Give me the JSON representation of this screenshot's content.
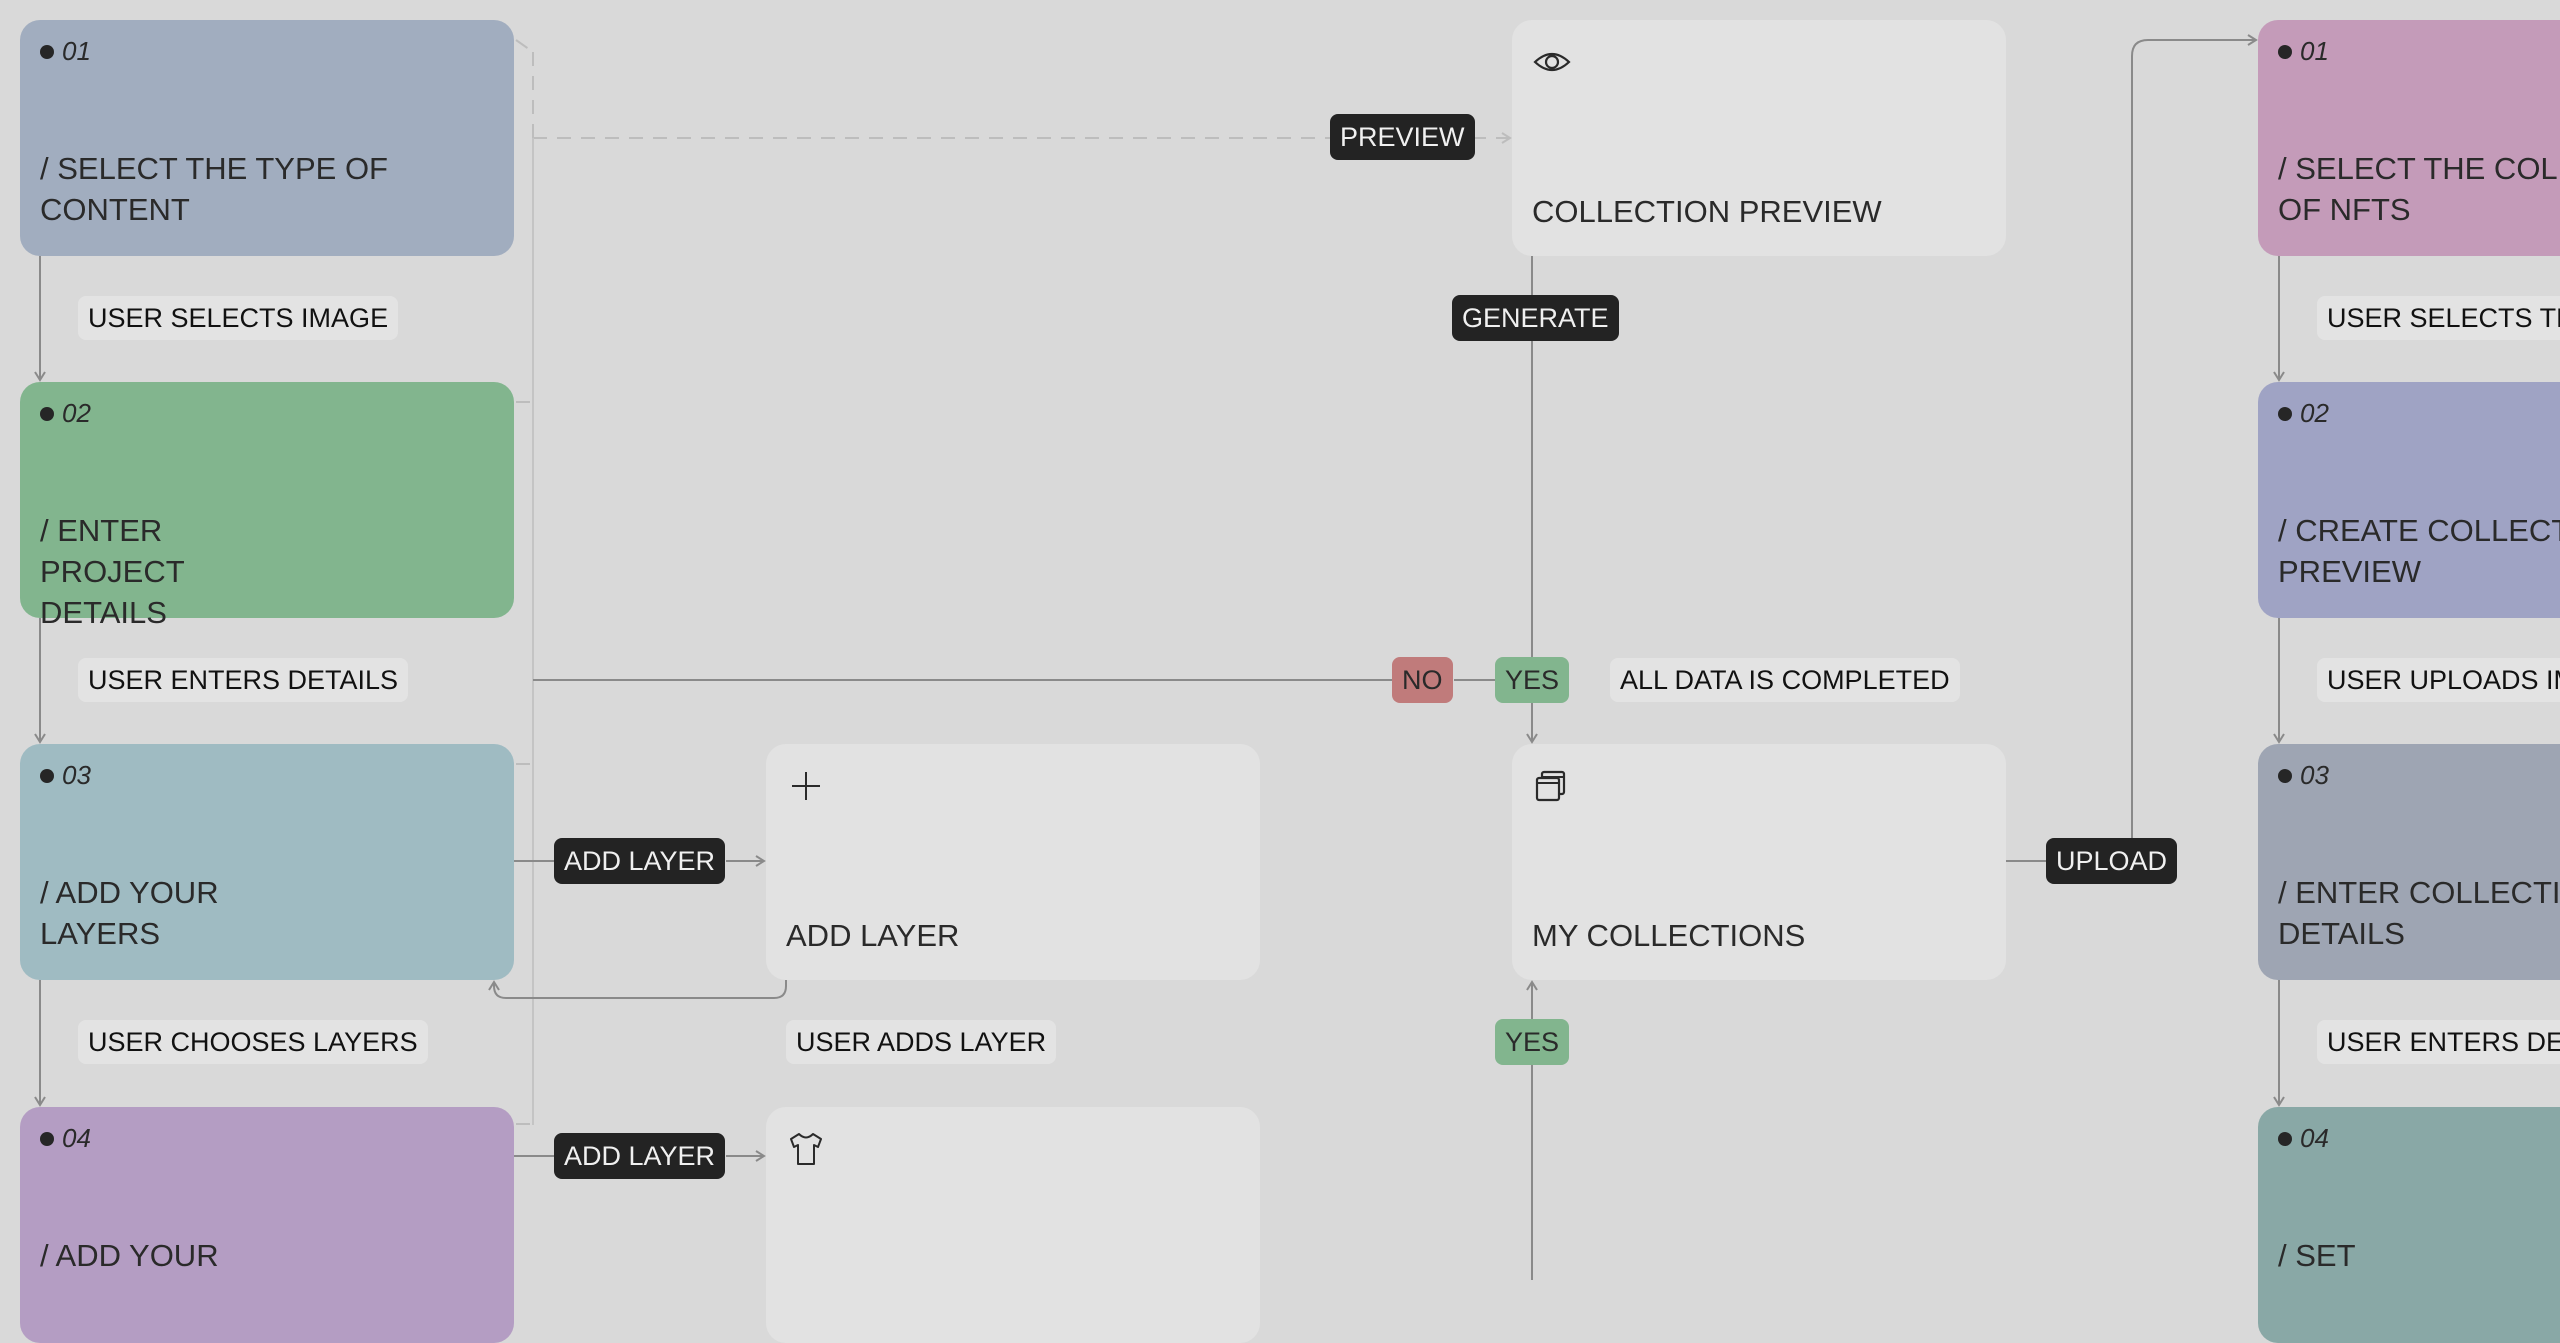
{
  "colors": {
    "background": "#d9d9d9",
    "screen_card": "#e2e2e2",
    "action_badge": "#232323",
    "yes_badge": "#82b58e",
    "no_badge": "#c07b7b"
  },
  "left_flow": {
    "steps": [
      {
        "number": "01",
        "title": "/ SELECT THE TYPE OF CONTENT",
        "color": "#a1adbf"
      },
      {
        "number": "02",
        "title": "/ ENTER PROJECT DETAILS",
        "color": "#82b58e"
      },
      {
        "number": "03",
        "title": "/ ADD YOUR LAYERS",
        "color": "#9fbbc2"
      },
      {
        "number": "04",
        "title": "/ ADD YOUR",
        "color": "#b49dc3"
      }
    ],
    "transitions": [
      "USER SELECTS IMAGE",
      "USER ENTERS DETAILS",
      "USER CHOOSES LAYERS"
    ]
  },
  "right_flow": {
    "steps": [
      {
        "number": "01",
        "title": "/ SELECT THE COLLECTION OF NFTS",
        "color": "#c49bb9"
      },
      {
        "number": "02",
        "title": "/ CREATE COLLECTION PREVIEW",
        "color": "#9fa3c4"
      },
      {
        "number": "03",
        "title": "/ ENTER COLLECTION DETAILS",
        "color": "#9ea5b3"
      },
      {
        "number": "04",
        "title": "/ SET",
        "color": "#89a8a6"
      }
    ],
    "transitions": [
      "USER SELECTS THE",
      "USER UPLOADS IMAGES",
      "USER ENTERS DETAILS"
    ]
  },
  "screens": {
    "collection_preview": {
      "label": "COLLECTION PREVIEW",
      "icon": "eye-icon"
    },
    "add_layer": {
      "label": "ADD LAYER",
      "icon": "plus-icon"
    },
    "my_collections": {
      "label": "MY COLLECTIONS",
      "icon": "stacked-windows-icon"
    },
    "layer_item": {
      "label": "",
      "icon": "tshirt-icon"
    }
  },
  "actions": {
    "preview": "PREVIEW",
    "generate": "GENERATE",
    "add_layer_1": "ADD LAYER",
    "add_layer_2": "ADD LAYER",
    "upload": "UPLOAD"
  },
  "decisions": {
    "no": "NO",
    "yes_top": "YES",
    "yes_bottom": "YES",
    "condition": "ALL DATA IS COMPLETED",
    "user_adds_layer": "USER ADDS LAYER"
  }
}
